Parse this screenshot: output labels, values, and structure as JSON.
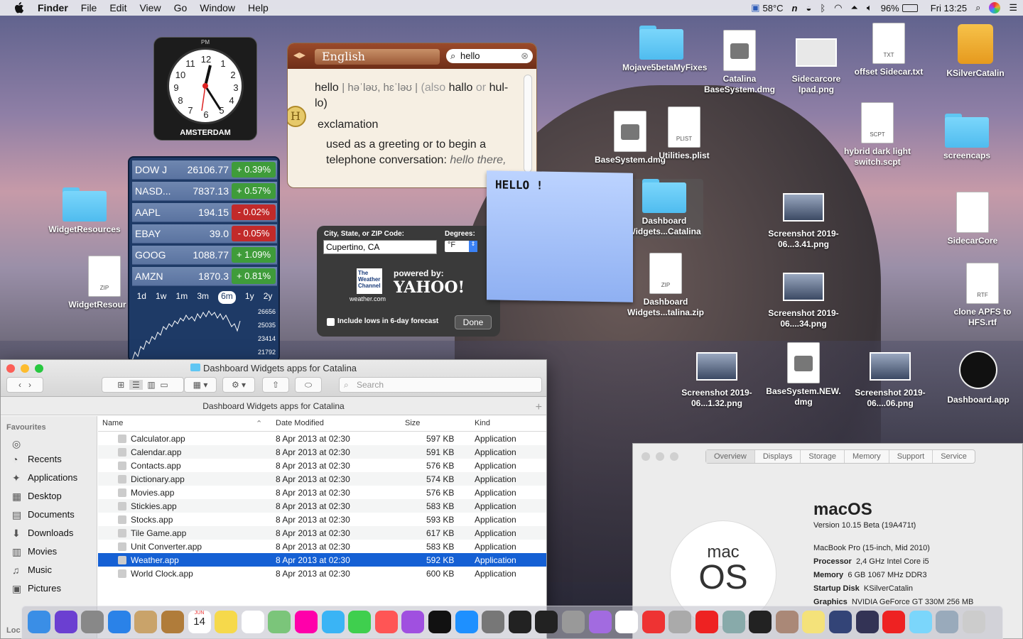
{
  "menubar": {
    "app": "Finder",
    "items": [
      "File",
      "Edit",
      "View",
      "Go",
      "Window",
      "Help"
    ],
    "temp": "58°C",
    "battery": "96%",
    "clock": "Fri 13:25"
  },
  "clock_widget": {
    "ampm": "PM",
    "city": "AMSTERDAM",
    "numbers": [
      "12",
      "1",
      "2",
      "3",
      "4",
      "5",
      "6",
      "7",
      "8",
      "9",
      "10",
      "11"
    ]
  },
  "stocks": {
    "rows": [
      {
        "sym": "DOW J",
        "val": "26106.77",
        "chg": "+ 0.39%",
        "dir": "up"
      },
      {
        "sym": "NASD...",
        "val": "7837.13",
        "chg": "+ 0.57%",
        "dir": "up"
      },
      {
        "sym": "AAPL",
        "val": "194.15",
        "chg": "- 0.02%",
        "dir": "down"
      },
      {
        "sym": "EBAY",
        "val": "39.0",
        "chg": "- 0.05%",
        "dir": "down"
      },
      {
        "sym": "GOOG",
        "val": "1088.77",
        "chg": "+ 1.09%",
        "dir": "up"
      },
      {
        "sym": "AMZN",
        "val": "1870.3",
        "chg": "+ 0.81%",
        "dir": "up"
      }
    ],
    "ranges": [
      "1d",
      "1w",
      "1m",
      "3m",
      "6m",
      "1y",
      "2y"
    ],
    "selected_range": "6m",
    "y_labels": [
      "26656",
      "25035",
      "23414",
      "21792"
    ]
  },
  "dictionary": {
    "language": "English",
    "search": "hello",
    "headword": "hello",
    "pron": "| həˈləʊ, hɛˈləʊ |",
    "also": "(also",
    "hallo": "hallo",
    "or": "or",
    "hullo": "hul-lo)",
    "pos": "exclamation",
    "def": "used as a greeting or to begin a telephone conversation:",
    "example": "hello there, Katie!",
    "badge": "H"
  },
  "sticky": {
    "text": "HELLO !"
  },
  "weather": {
    "city_label": "City, State, or ZIP Code:",
    "degrees_label": "Degrees:",
    "city": "Cupertino, CA",
    "degrees": "°F",
    "twc": "The Weather Channel",
    "twc_url": "weather.com",
    "powered": "powered by:",
    "yahoo": "YAHOO!",
    "lows": "Include lows in 6-day forecast",
    "done": "Done"
  },
  "desktop": [
    {
      "label": "Mojave5betaMyFixes",
      "kind": "folder"
    },
    {
      "label": "Catalina BaseSystem.dmg",
      "kind": "dmg"
    },
    {
      "label": "Sidecarcore Ipad.png",
      "kind": "png"
    },
    {
      "label": "offset Sidecar.txt",
      "kind": "txt",
      "ext": "TXT"
    },
    {
      "label": "KSilverCatalin",
      "kind": "drive"
    },
    {
      "label": "BaseSystem.dmg",
      "kind": "dmg"
    },
    {
      "label": "Utilities.plist",
      "kind": "doc",
      "ext": "PLIST"
    },
    {
      "label": "hybrid dark light switch.scpt",
      "kind": "doc",
      "ext": "SCPT"
    },
    {
      "label": "screencaps",
      "kind": "folder"
    },
    {
      "label": "WidgetResources",
      "kind": "folder"
    },
    {
      "label": "Dashboard Widgets...Catalina",
      "kind": "folder"
    },
    {
      "label": "Screenshot 2019-06...3.41.png",
      "kind": "png"
    },
    {
      "label": "SidecarCore",
      "kind": "doc"
    },
    {
      "label": "WidgetResour zip",
      "kind": "zip",
      "ext": "ZIP"
    },
    {
      "label": "Dashboard Widgets...talina.zip",
      "kind": "zip",
      "ext": "ZIP"
    },
    {
      "label": "Screenshot 2019-06....34.png",
      "kind": "png"
    },
    {
      "label": "clone APFS to HFS.rtf",
      "kind": "doc",
      "ext": "RTF"
    },
    {
      "label": "Screenshot 2019-06...1.32.png",
      "kind": "png"
    },
    {
      "label": "BaseSystem.NEW. dmg",
      "kind": "dmg"
    },
    {
      "label": "Screenshot 2019-06....06.png",
      "kind": "png"
    },
    {
      "label": "Dashboard.app",
      "kind": "app"
    }
  ],
  "finder": {
    "title": "Dashboard Widgets apps for Catalina",
    "path": "Dashboard Widgets apps for Catalina",
    "search_placeholder": "Search",
    "favourites_label": "Favourites",
    "sidebar": [
      {
        "label": "Recents",
        "icon": "recents-icon",
        "g": "◔"
      },
      {
        "label": "Applications",
        "icon": "applications-icon",
        "g": "✦"
      },
      {
        "label": "Desktop",
        "icon": "desktop-icon",
        "g": "▦"
      },
      {
        "label": "Documents",
        "icon": "documents-icon",
        "g": "▤"
      },
      {
        "label": "Downloads",
        "icon": "downloads-icon",
        "g": "⬇"
      },
      {
        "label": "Movies",
        "icon": "movies-icon",
        "g": "▥"
      },
      {
        "label": "Music",
        "icon": "music-icon",
        "g": "♫"
      },
      {
        "label": "Pictures",
        "icon": "pictures-icon",
        "g": "▣"
      }
    ],
    "locations_label": "Loc",
    "columns": {
      "name": "Name",
      "date": "Date Modified",
      "size": "Size",
      "kind": "Kind"
    },
    "rows": [
      {
        "name": "Calculator.app",
        "date": "8 Apr 2013 at 02:30",
        "size": "597 KB",
        "kind": "Application"
      },
      {
        "name": "Calendar.app",
        "date": "8 Apr 2013 at 02:30",
        "size": "591 KB",
        "kind": "Application"
      },
      {
        "name": "Contacts.app",
        "date": "8 Apr 2013 at 02:30",
        "size": "576 KB",
        "kind": "Application"
      },
      {
        "name": "Dictionary.app",
        "date": "8 Apr 2013 at 02:30",
        "size": "574 KB",
        "kind": "Application"
      },
      {
        "name": "Movies.app",
        "date": "8 Apr 2013 at 02:30",
        "size": "576 KB",
        "kind": "Application"
      },
      {
        "name": "Stickies.app",
        "date": "8 Apr 2013 at 02:30",
        "size": "583 KB",
        "kind": "Application"
      },
      {
        "name": "Stocks.app",
        "date": "8 Apr 2013 at 02:30",
        "size": "593 KB",
        "kind": "Application"
      },
      {
        "name": "Tile Game.app",
        "date": "8 Apr 2013 at 02:30",
        "size": "617 KB",
        "kind": "Application"
      },
      {
        "name": "Unit Converter.app",
        "date": "8 Apr 2013 at 02:30",
        "size": "583 KB",
        "kind": "Application"
      },
      {
        "name": "Weather.app",
        "date": "8 Apr 2013 at 02:30",
        "size": "592 KB",
        "kind": "Application",
        "selected": true
      },
      {
        "name": "World Clock.app",
        "date": "8 Apr 2013 at 02:30",
        "size": "600 KB",
        "kind": "Application"
      }
    ]
  },
  "about": {
    "tabs": [
      "Overview",
      "Displays",
      "Storage",
      "Memory",
      "Support",
      "Service"
    ],
    "os": "macOS",
    "version_label": "Version",
    "version": "10.15 Beta (19A471t)",
    "model": "MacBook Pro (15-inch, Mid 2010)",
    "specs": [
      {
        "k": "Processor",
        "v": "2,4 GHz Intel Core i5"
      },
      {
        "k": "Memory",
        "v": "6 GB 1067 MHz DDR3"
      },
      {
        "k": "Startup Disk",
        "v": "KSilverCatalin"
      },
      {
        "k": "Graphics",
        "v": "NVIDIA GeForce GT 330M 256 MB"
      }
    ],
    "logo_top": "mac",
    "logo_bottom": "OS"
  },
  "dock": {
    "apps": [
      "finder",
      "siri",
      "launchpad",
      "safari",
      "mail",
      "contacts",
      "calendar",
      "notes",
      "reminders",
      "maps",
      "photos",
      "messages",
      "facetime",
      "music",
      "podcasts",
      "tv",
      "app-store",
      "system-preferences",
      "terminal",
      "activity-monitor",
      "disk-utility",
      "feedback",
      "textedit",
      "news",
      "dictionary",
      "stop",
      "preview",
      "clock",
      "ruler",
      "stickies",
      "ibooks",
      "keyboard",
      "stop2",
      "folder",
      "downloads",
      "trash"
    ],
    "calendar_day": "14",
    "calendar_month": "JUN"
  }
}
